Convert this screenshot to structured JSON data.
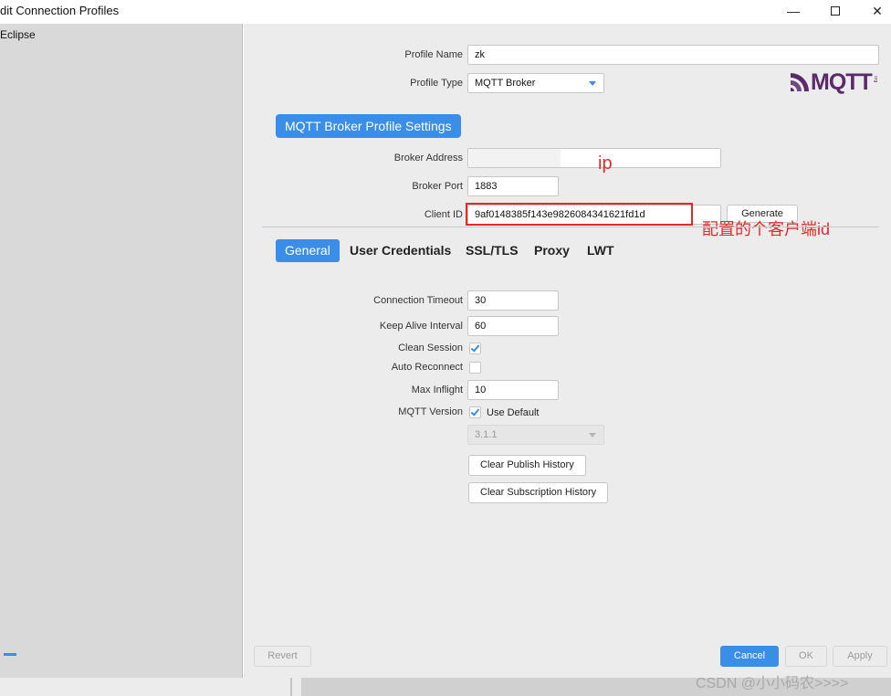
{
  "window": {
    "title": "dit Connection Profiles",
    "minimize_glyph": "—",
    "close_glyph": "✕"
  },
  "sidebar": {
    "items": [
      {
        "label": "Eclipse"
      }
    ]
  },
  "profile": {
    "name_label": "Profile Name",
    "name_value": "zk",
    "type_label": "Profile Type",
    "type_value": "MQTT Broker"
  },
  "logo": {
    "text": "MQTT",
    "sub": "org"
  },
  "broker_section": {
    "title": "MQTT Broker Profile Settings",
    "address_label": "Broker Address",
    "address_value": "",
    "port_label": "Broker Port",
    "port_value": "1883",
    "client_id_label": "Client ID",
    "client_id_value": "9af0148385f143e9826084341621fd1d",
    "generate_label": "Generate"
  },
  "annotations": {
    "ip": "ip",
    "client_id_note": "配置的个客户端id"
  },
  "tabs": [
    {
      "label": "General",
      "active": true
    },
    {
      "label": "User Credentials",
      "active": false
    },
    {
      "label": "SSL/TLS",
      "active": false
    },
    {
      "label": "Proxy",
      "active": false
    },
    {
      "label": "LWT",
      "active": false
    }
  ],
  "general": {
    "connection_timeout_label": "Connection Timeout",
    "connection_timeout_value": "30",
    "keep_alive_label": "Keep Alive Interval",
    "keep_alive_value": "60",
    "clean_session_label": "Clean Session",
    "clean_session_checked": true,
    "auto_reconnect_label": "Auto Reconnect",
    "auto_reconnect_checked": false,
    "max_inflight_label": "Max Inflight",
    "max_inflight_value": "10",
    "mqtt_version_label": "MQTT Version",
    "use_default_label": "Use Default",
    "use_default_checked": true,
    "version_value": "3.1.1",
    "clear_publish_label": "Clear Publish History",
    "clear_subscription_label": "Clear Subscription History"
  },
  "footer": {
    "revert_label": "Revert",
    "cancel_label": "Cancel",
    "ok_label": "OK",
    "apply_label": "Apply"
  },
  "watermark": "CSDN @小小码农>>>>",
  "colors": {
    "accent": "#3b8ee8",
    "annotation_red": "#e12a2a",
    "logo_purple": "#5b2a6b"
  }
}
